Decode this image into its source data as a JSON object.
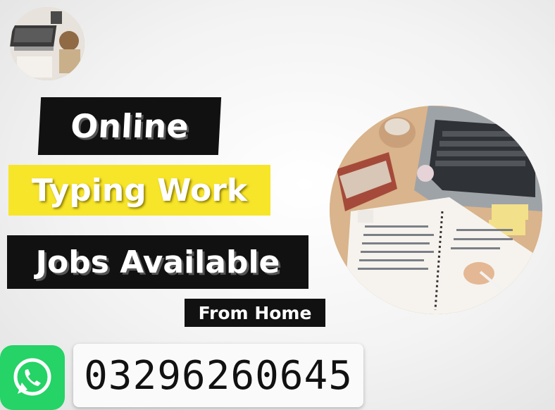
{
  "headline": {
    "line1": "Online",
    "line2": "Typing Work",
    "line3": "Jobs Available",
    "line4": "From Home"
  },
  "contact": {
    "phone": "03296260645",
    "icon": "whatsapp-icon",
    "icon_color": "#25d366"
  },
  "colors": {
    "dark_tag": "#111111",
    "yellow_tag": "#f7e52a"
  }
}
